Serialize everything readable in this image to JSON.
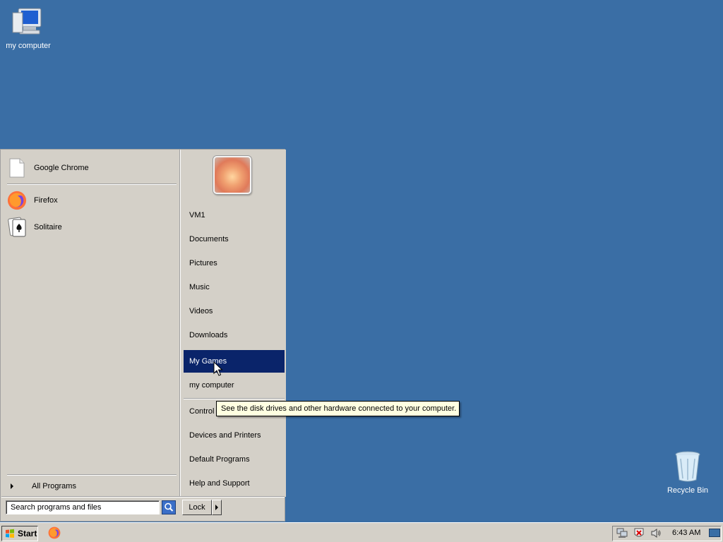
{
  "desktop": {
    "icons": [
      {
        "label": "my computer",
        "icon": "computer-icon"
      },
      {
        "label": "Recycle Bin",
        "icon": "recycle-bin-icon"
      }
    ]
  },
  "start_menu": {
    "pinned": [
      {
        "label": "Google Chrome",
        "icon": "blank-document-icon"
      }
    ],
    "recent": [
      {
        "label": "Firefox",
        "icon": "firefox-icon"
      },
      {
        "label": "Solitaire",
        "icon": "solitaire-icon"
      }
    ],
    "all_programs_label": "All Programs",
    "search_placeholder": "Search programs and files",
    "right_items": [
      {
        "label": "VM1"
      },
      {
        "label": "Documents"
      },
      {
        "label": "Pictures"
      },
      {
        "label": "Music"
      },
      {
        "label": "Videos"
      },
      {
        "label": "Downloads"
      },
      {
        "label": "My Games",
        "highlighted": true
      },
      {
        "label": "my computer"
      },
      {
        "label": "Control Panel"
      },
      {
        "label": "Devices and Printers"
      },
      {
        "label": "Default Programs"
      },
      {
        "label": "Help and Support"
      }
    ],
    "lock_label": "Lock",
    "tooltip": "See the disk drives and other hardware connected to your computer."
  },
  "taskbar": {
    "start_label": "Start",
    "clock": "6:43 AM",
    "tray_icons": [
      "network-icon",
      "security-alert-icon",
      "volume-icon"
    ]
  },
  "colors": {
    "desktop": "#3a6ea5",
    "menu_bg": "#d4d0c8",
    "highlight": "#0a246a",
    "tooltip_bg": "#ffffe1"
  }
}
